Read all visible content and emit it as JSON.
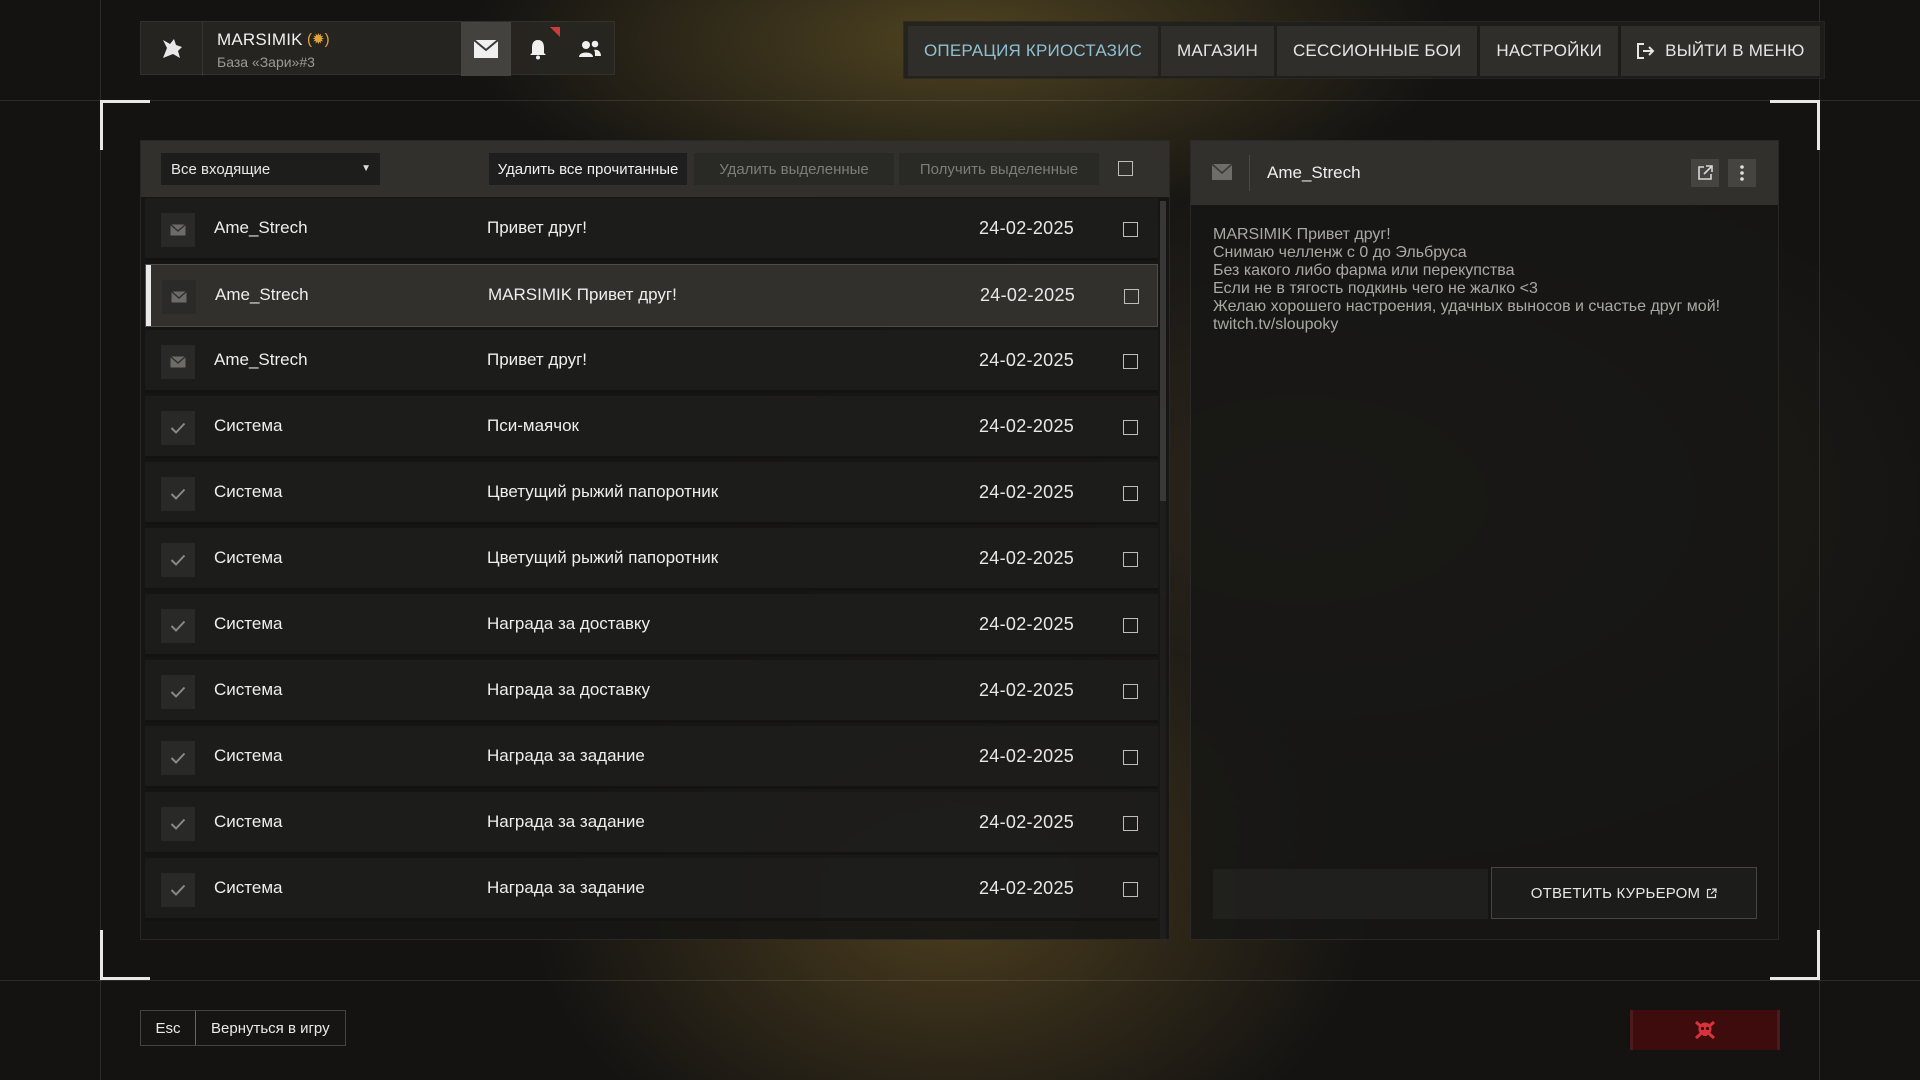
{
  "profile": {
    "name": "MARSIMIK",
    "badge": "(✹)",
    "base": "База «Зари»#3"
  },
  "top_icons": [
    "mail-icon",
    "bell-icon",
    "users-icon"
  ],
  "menu": {
    "items": [
      "ОПЕРАЦИЯ КРИОСТАЗИС",
      "МАГАЗИН",
      "СЕССИОННЫЕ БОИ",
      "НАСТРОЙКИ"
    ],
    "exit": "ВЫЙТИ В МЕНЮ",
    "active_color": "#8fc0d2"
  },
  "mail_toolbar": {
    "filter": "Все входящие",
    "delete_read": "Удалить все прочитанные",
    "delete_selected": "Удалить выделенные",
    "get_selected": "Получить выделенные"
  },
  "messages": [
    {
      "icon": "envelope-icon",
      "sender": "Ame_Strech",
      "subject": "Привет друг!",
      "date": "24-02-2025"
    },
    {
      "icon": "envelope-icon",
      "sender": "Ame_Strech",
      "subject": "MARSIMIK Привет друг!",
      "date": "24-02-2025"
    },
    {
      "icon": "envelope-icon",
      "sender": "Ame_Strech",
      "subject": "Привет друг!",
      "date": "24-02-2025"
    },
    {
      "icon": "check-icon",
      "sender": "Система",
      "subject": "Пси-маячок",
      "date": "24-02-2025"
    },
    {
      "icon": "check-icon",
      "sender": "Система",
      "subject": "Цветущий рыжий папоротник",
      "date": "24-02-2025"
    },
    {
      "icon": "check-icon",
      "sender": "Система",
      "subject": "Цветущий рыжий папоротник",
      "date": "24-02-2025"
    },
    {
      "icon": "check-icon",
      "sender": "Система",
      "subject": "Награда за доставку",
      "date": "24-02-2025"
    },
    {
      "icon": "check-icon",
      "sender": "Система",
      "subject": "Награда за доставку",
      "date": "24-02-2025"
    },
    {
      "icon": "check-icon",
      "sender": "Система",
      "subject": "Награда за задание",
      "date": "24-02-2025"
    },
    {
      "icon": "check-icon",
      "sender": "Система",
      "subject": "Награда за задание",
      "date": "24-02-2025"
    },
    {
      "icon": "check-icon",
      "sender": "Система",
      "subject": "Награда за задание",
      "date": "24-02-2025"
    }
  ],
  "selected_message_index": 1,
  "reader": {
    "sender": "Ame_Strech",
    "body": "MARSIMIK Привет друг!\nСнимаю челленж с 0 до Эльбруса\nБез какого либо фарма или перекупства\nЕсли не в тягость подкинь чего не жалко <3\nЖелаю хорошего настроения, удачных выносов и счастье друг мой!\ntwitch.tv/sloupoky",
    "reply_button": "ОТВЕТИТЬ КУРЬЕРОМ"
  },
  "bottom": {
    "esc_key": "Esc",
    "esc_label": "Вернуться в игру",
    "danger_icon": "skull-crossbones-icon",
    "danger_color": "#d8333a"
  }
}
